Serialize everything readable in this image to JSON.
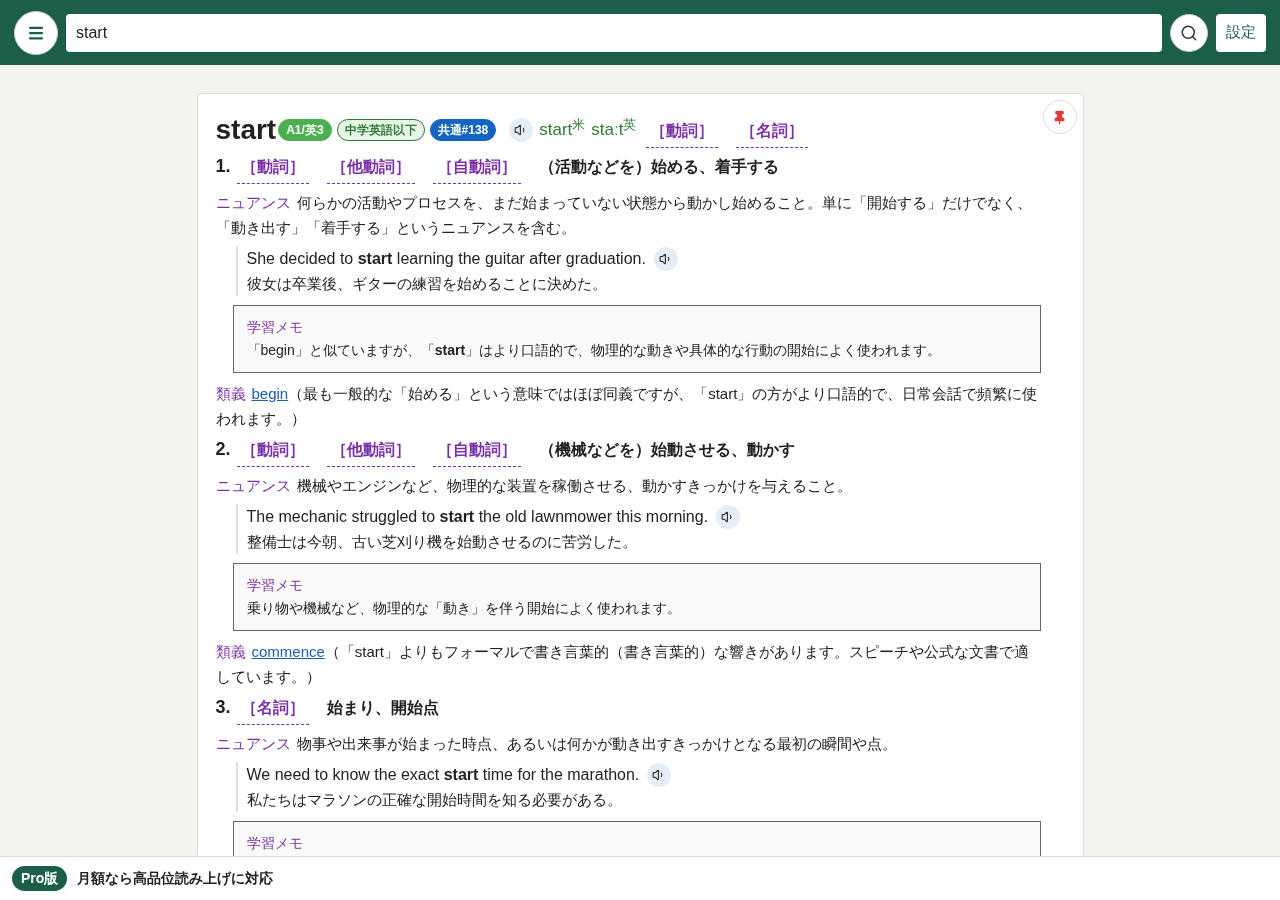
{
  "header": {
    "search": {
      "value": "start"
    },
    "settings_button": "設定"
  },
  "entry": {
    "headword": "start",
    "badges": [
      {
        "label": "A1/英3",
        "kind": "solid",
        "color": "#4caf50"
      },
      {
        "label": "中学英語以下",
        "kind": "outline",
        "color": "#2e7d32"
      },
      {
        "label": "共通#138",
        "kind": "solid",
        "color": "#1565c0"
      }
    ],
    "pronunciations": [
      "start$^{米}$",
      "staːt$^{英}$"
    ],
    "parts_of_speech": [
      "［動詞］",
      "［名詞］"
    ],
    "senses": [
      {
        "number": "1.",
        "parts_of_speech": [
          "［動詞］",
          "［他動詞］",
          "［自動詞］"
        ],
        "gloss": "（活動などを）始める、着手する",
        "nuance_label": "ニュアンス",
        "nuance": "何らかの活動やプロセスを、まだ始まっていない状態から動かし始めること。単に「開始する」だけでなく、「動き出す」「着手する」というニュアンスを含む。",
        "example_en": "She decided to **start** learning the guitar after graduation.",
        "example_ja": "彼女は卒業後、ギターの練習を始めることに決めた。",
        "memo": {
          "label": "学習メモ",
          "text": "「begin」と似ていますが、「**start**」はより口語的で、物理的な動きや具体的な行動の開始によく使われます。"
        },
        "synonym": {
          "label": "類義",
          "word": "begin",
          "text": "（最も一般的な「始める」という意味ではほぼ同義ですが、「start」の方がより口語的で、日常会話で頻繁に使われます。）"
        }
      },
      {
        "number": "2.",
        "parts_of_speech": [
          "［動詞］",
          "［他動詞］",
          "［自動詞］"
        ],
        "gloss": "（機械などを）始動させる、動かす",
        "nuance_label": "ニュアンス",
        "nuance": "機械やエンジンなど、物理的な装置を稼働させる、動かすきっかけを与えること。",
        "example_en": "The mechanic struggled to **start** the old lawnmower this morning.",
        "example_ja": "整備士は今朝、古い芝刈り機を始動させるのに苦労した。",
        "memo": {
          "label": "学習メモ",
          "text": "乗り物や機械など、物理的な「動き」を伴う開始によく使われます。"
        },
        "synonym": {
          "label": "類義",
          "word": "commence",
          "text": "（「start」よりもフォーマルで書き言葉的（書き言葉的）な響きがあります。スピーチや公式な文書で適しています。）"
        }
      },
      {
        "number": "3.",
        "parts_of_speech": [
          "［名詞］"
        ],
        "gloss": "始まり、開始点",
        "nuance_label": "ニュアンス",
        "nuance": "物事や出来事が始まった時点、あるいは何かが動き出すきっかけとなる最初の瞬間や点。",
        "example_en": "We need to know the exact **start** time for the marathon.",
        "example_ja": "私たちはマラソンの正確な開始時間を知る必要がある。",
        "memo": {
          "label": "学習メモ"
        }
      }
    ]
  },
  "footer": {
    "badge": "Pro版",
    "text": "月額なら高品位読み上げに対応"
  }
}
